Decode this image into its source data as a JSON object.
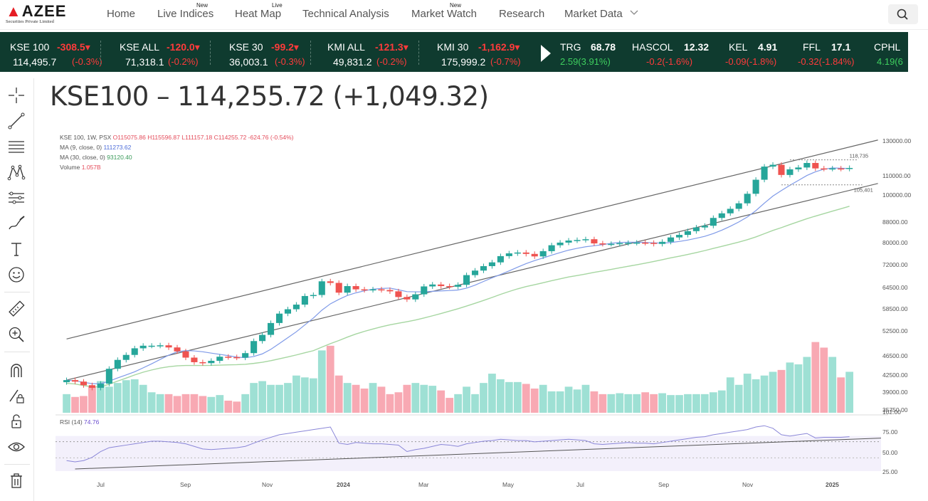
{
  "brand": {
    "name": "AZEE",
    "tagline": "Securities Private Limited"
  },
  "nav": [
    {
      "label": "Home",
      "badge": ""
    },
    {
      "label": "Live Indices",
      "badge": "New"
    },
    {
      "label": "Heat Map",
      "badge": "Live"
    },
    {
      "label": "Technical Analysis",
      "badge": ""
    },
    {
      "label": "Market Watch",
      "badge": "New"
    },
    {
      "label": "Research",
      "badge": ""
    },
    {
      "label": "Market Data",
      "badge": ""
    }
  ],
  "indices": [
    {
      "name": "KSE 100",
      "change": "-308.5",
      "value": "114,495.7",
      "pct": "(-0.3%)"
    },
    {
      "name": "KSE ALL",
      "change": "-120.0",
      "value": "71,318.1",
      "pct": "(-0.2%)"
    },
    {
      "name": "KSE 30",
      "change": "-99.2",
      "value": "36,003.1",
      "pct": "(-0.3%)"
    },
    {
      "name": "KMI ALL",
      "change": "-121.3",
      "value": "49,831.2",
      "pct": "(-0.2%)"
    },
    {
      "name": "KMI 30",
      "change": "-1,162.9",
      "value": "175,999.2",
      "pct": "(-0.7%)"
    }
  ],
  "symbols": [
    {
      "name": "TRG",
      "price": "68.78",
      "change": "2.59(3.91%)",
      "up": true
    },
    {
      "name": "HASCOL",
      "price": "12.32",
      "change": "-0.2(-1.6%)",
      "up": false
    },
    {
      "name": "KEL",
      "price": "4.91",
      "change": "-0.09(-1.8%)",
      "up": false
    },
    {
      "name": "FFL",
      "price": "17.1",
      "change": "-0.32(-1.84%)",
      "up": false
    },
    {
      "name": "CPHL",
      "price": "",
      "change": "4.19(6",
      "up": true
    }
  ],
  "colors": {
    "ticker_bg": "#0f3b2f",
    "up": "#26a69a",
    "down": "#ef5350",
    "up_text": "#3ecf5e",
    "down_text": "#ff3b3b"
  },
  "tools": [
    "crosshair-icon",
    "trendline-icon",
    "fib-levels-icon",
    "pattern-icon",
    "prediction-icon",
    "brush-icon",
    "text-icon",
    "emoji-icon",
    "ruler-icon",
    "zoom-in-icon",
    "magnet-icon",
    "lock-draw-icon",
    "lock-icon",
    "eye-icon",
    "trash-icon"
  ],
  "chart_title": "KSE100 – 114,255.72 (+1,049.32)",
  "chart_data": {
    "type": "candlestick",
    "title": "KSE100 – 114,255.72 (+1,049.32)",
    "legend": {
      "main": "KSE 100, 1W, PSX",
      "ohlc": "O115075.86  H115596.87  L111157.18  C114255.72  -624.76 (-0.54%)",
      "ma9_label": "MA (9, close, 0)",
      "ma9_value": "111273.62",
      "ma30_label": "MA (30, close, 0)",
      "ma30_value": "93120.40",
      "volume_label": "Volume",
      "volume_value": "1.057B"
    },
    "price_ticks": [
      "130000.00",
      "110000.00",
      "100000.00",
      "88000.00",
      "80000.00",
      "72000.00",
      "64500.00",
      "58500.00",
      "52500.00",
      "46500.00",
      "42500.00",
      "39000.00",
      "35750.00"
    ],
    "rsi_ticks": [
      "102.00",
      "75.00",
      "50.00",
      "25.00"
    ],
    "x_ticks": [
      "Jul",
      "Sep",
      "Nov",
      "2024",
      "Mar",
      "May",
      "Jul",
      "Sep",
      "Nov",
      "2025"
    ],
    "annotations": {
      "high": "118,735",
      "low": "105,401"
    },
    "rsi_label": "RSI (14)",
    "rsi_value": "74.76",
    "closes": [
      41500,
      41200,
      40500,
      40000,
      40800,
      43800,
      45700,
      46800,
      48300,
      48900,
      48900,
      49000,
      48500,
      47600,
      46200,
      45200,
      45000,
      45500,
      46400,
      46300,
      46200,
      47200,
      50000,
      51500,
      54500,
      57000,
      58200,
      59500,
      62000,
      62300,
      66500,
      66000,
      63000,
      65000,
      64000,
      63800,
      64000,
      63800,
      63400,
      61700,
      61000,
      62500,
      64900,
      65500,
      65000,
      64800,
      65400,
      68500,
      70000,
      71500,
      72800,
      75000,
      76000,
      76300,
      75800,
      74900,
      76800,
      79000,
      80000,
      80800,
      81000,
      81300,
      79700,
      79500,
      79500,
      79800,
      79900,
      80000,
      79900,
      79500,
      80300,
      82000,
      83000,
      84500,
      86000,
      86700,
      90000,
      92000,
      94000,
      96500,
      101000,
      108000,
      115000,
      116000,
      110500,
      113500,
      114500,
      117000,
      114000,
      113800,
      114000,
      113800,
      114255
    ],
    "volumes": [
      0.2,
      0.17,
      0.18,
      0.28,
      0.34,
      0.28,
      0.32,
      0.35,
      0.36,
      0.3,
      0.22,
      0.2,
      0.2,
      0.18,
      0.2,
      0.2,
      0.18,
      0.17,
      0.19,
      0.13,
      0.12,
      0.2,
      0.32,
      0.34,
      0.3,
      0.3,
      0.32,
      0.4,
      0.38,
      0.37,
      0.67,
      0.72,
      0.4,
      0.32,
      0.3,
      0.26,
      0.32,
      0.28,
      0.2,
      0.22,
      0.3,
      0.32,
      0.3,
      0.29,
      0.24,
      0.16,
      0.2,
      0.28,
      0.2,
      0.32,
      0.42,
      0.36,
      0.33,
      0.33,
      0.31,
      0.26,
      0.3,
      0.23,
      0.23,
      0.28,
      0.25,
      0.3,
      0.23,
      0.2,
      0.2,
      0.21,
      0.2,
      0.2,
      0.22,
      0.2,
      0.21,
      0.19,
      0.19,
      0.2,
      0.2,
      0.2,
      0.22,
      0.24,
      0.38,
      0.3,
      0.42,
      0.36,
      0.4,
      0.44,
      0.46,
      0.54,
      0.52,
      0.6,
      0.76,
      0.7,
      0.6,
      0.38,
      0.44,
      0.62,
      0.5,
      0.36,
      0.3,
      0.48,
      0.34
    ],
    "rsi": [
      38,
      36,
      38,
      43,
      52,
      58,
      60,
      62,
      64,
      66,
      68,
      68,
      67,
      66,
      64,
      60,
      56,
      55,
      56,
      57,
      58,
      60,
      65,
      70,
      74,
      78,
      80,
      82,
      84,
      86,
      88,
      90,
      65,
      63,
      66,
      65,
      64,
      64,
      63,
      62,
      52,
      55,
      57,
      60,
      63,
      62,
      60,
      64,
      66,
      68,
      69,
      71,
      70,
      69,
      69,
      67,
      68,
      69,
      70,
      71,
      70,
      69,
      64,
      63,
      64,
      65,
      66,
      65,
      65,
      64,
      66,
      68,
      70,
      72,
      74,
      75,
      78,
      80,
      82,
      84,
      86,
      90,
      92,
      88,
      78,
      76,
      78,
      80,
      73,
      74,
      74,
      74,
      75
    ],
    "regression_channel": {
      "upper": [
        {
          "x": 0,
          "y": 50500
        },
        {
          "x": 92,
          "y": 128000
        }
      ],
      "lower": [
        {
          "x": 0,
          "y": 41500
        },
        {
          "x": 92,
          "y": 104000
        }
      ]
    }
  }
}
